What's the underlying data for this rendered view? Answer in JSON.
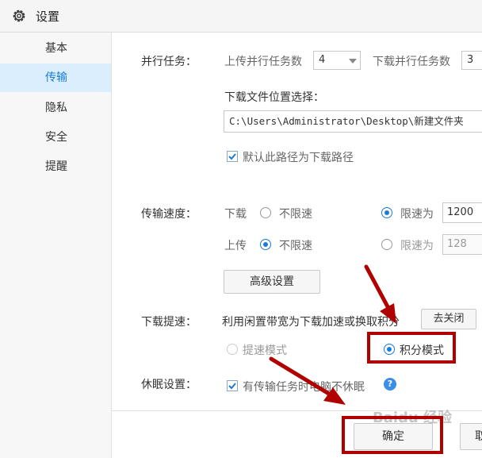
{
  "window": {
    "title": "设置"
  },
  "sidebar": {
    "items": [
      {
        "label": "基本"
      },
      {
        "label": "传输",
        "active": true
      },
      {
        "label": "隐私"
      },
      {
        "label": "安全"
      },
      {
        "label": "提醒"
      }
    ]
  },
  "parallel": {
    "label": "并行任务：",
    "upload_label": "上传并行任务数",
    "upload_value": "4",
    "download_label": "下载并行任务数",
    "download_value": "3"
  },
  "download_location": {
    "label": "下载文件位置选择：",
    "path": "C:\\Users\\Administrator\\Desktop\\新建文件夹",
    "default_checkbox_label": "默认此路径为下载路径",
    "default_checked": true
  },
  "speed": {
    "label": "传输速度：",
    "download_label": "下载",
    "upload_label": "上传",
    "unlimited_label": "不限速",
    "limit_label": "限速为",
    "download_mode": "limit",
    "download_limit_value": "1200",
    "upload_mode": "unlimited",
    "upload_limit_value": "128",
    "advanced_button": "高级设置"
  },
  "boost": {
    "label": "下载提速：",
    "description": "利用闲置带宽为下载加速或换取积分",
    "close_button": "去关闭",
    "speed_mode_label": "提速模式",
    "points_mode_label": "积分模式",
    "selected_mode": "points"
  },
  "sleep": {
    "label": "休眠设置：",
    "checkbox_label": "有传输任务时电脑不休眠",
    "checked": true,
    "help_icon": "?"
  },
  "footer": {
    "ok_button": "确定",
    "cancel_button": "取"
  },
  "watermark": "Baidu 经验",
  "colors": {
    "accent": "#1a7bd9",
    "annotation_red": "#b00000",
    "selected_bg": "#dbeefe"
  }
}
